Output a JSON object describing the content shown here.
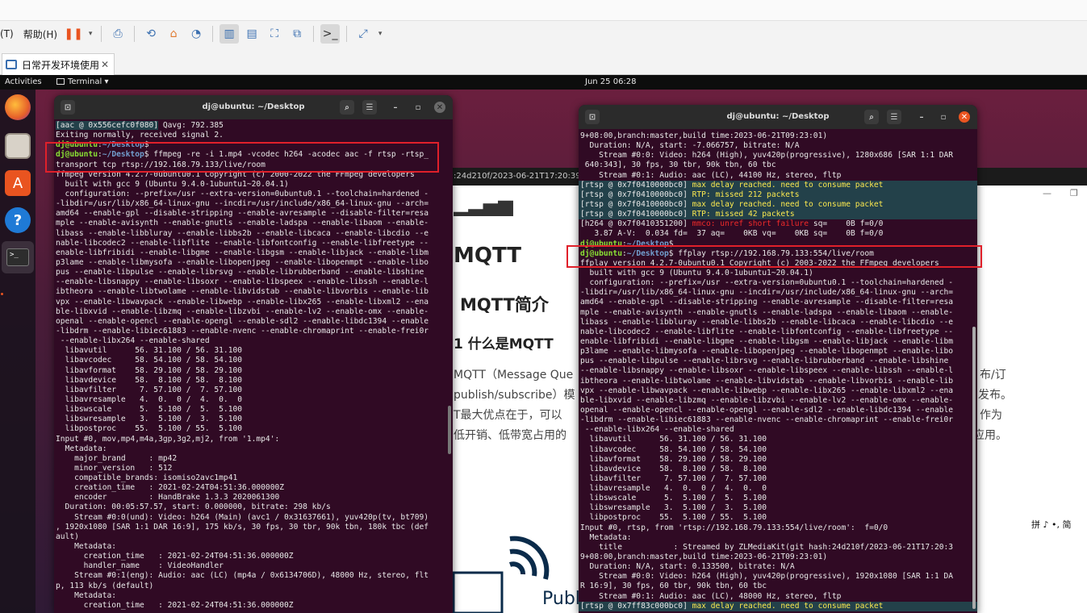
{
  "vm_app": {
    "menu_items": [
      "(T)",
      "帮助(H)"
    ],
    "tab_title": "日常开发环境使用",
    "tab_close": "✕"
  },
  "gnome": {
    "activities": "Activities",
    "app_menu": "Terminal ▾",
    "clock": "Jun 25  06:28"
  },
  "dock_apps": [
    "firefox-icon",
    "files-icon",
    "software-icon",
    "help-icon",
    "terminal-icon"
  ],
  "browser": {
    "url_fragment": ":24d210f/2023-06-21T17:20:39+08:",
    "heading_mqtt": "MQTT",
    "subheading": "MQTT简介",
    "section": "1 什么是MQTT",
    "para1": "MQTT（Message Que",
    "para1_right": "布/订",
    "para2": "publish/subscribe）模",
    "para2_right": "发布。",
    "para3": "T最大优点在于，可以",
    "para3_right": "作为",
    "para4": "低开销、低带宽占用的",
    "para4_right": "应用。",
    "bottom_text": "Publ",
    "ime": "拼 ♪ •, 简"
  },
  "left_terminal": {
    "title": "dj@ubuntu: ~/Desktop",
    "lines": [
      {
        "parts": [
          {
            "t": "[aac @ 0x556cefc0f080]",
            "c": "hl"
          },
          {
            "t": " Qavg: 792.385"
          }
        ]
      },
      {
        "parts": [
          {
            "t": "Exiting normally, received signal 2."
          }
        ]
      },
      {
        "parts": [
          {
            "t": "dj@ubuntu",
            "c": "g"
          },
          {
            "t": ":"
          },
          {
            "t": "~/Desktop",
            "c": "b"
          },
          {
            "t": "$"
          }
        ]
      },
      {
        "parts": [
          {
            "t": "dj@ubuntu",
            "c": "g"
          },
          {
            "t": ":"
          },
          {
            "t": "~/Desktop",
            "c": "b"
          },
          {
            "t": "$ ffmpeg -re -i 1.mp4 -vcodec h264 -acodec aac -f rtsp -rtsp_"
          }
        ]
      },
      {
        "parts": [
          {
            "t": "transport tcp rtsp://192.168.79.133/live/room"
          }
        ]
      },
      {
        "parts": [
          {
            "t": "ffmpeg version 4.2.7-0ubuntu0.1 Copyright (c) 2000-2022 the FFmpeg developers"
          }
        ]
      },
      {
        "parts": [
          {
            "t": "  built with gcc 9 (Ubuntu 9.4.0-1ubuntu1~20.04.1)"
          }
        ]
      },
      {
        "parts": [
          {
            "t": "  configuration: --prefix=/usr --extra-version=0ubuntu0.1 --toolchain=hardened -"
          }
        ]
      },
      {
        "parts": [
          {
            "t": "-libdir=/usr/lib/x86_64-linux-gnu --incdir=/usr/include/x86_64-linux-gnu --arch="
          }
        ]
      },
      {
        "parts": [
          {
            "t": "amd64 --enable-gpl --disable-stripping --enable-avresample --disable-filter=resa"
          }
        ]
      },
      {
        "parts": [
          {
            "t": "mple --enable-avisynth --enable-gnutls --enable-ladspa --enable-libaom --enable-"
          }
        ]
      },
      {
        "parts": [
          {
            "t": "libass --enable-libbluray --enable-libbs2b --enable-libcaca --enable-libcdio --e"
          }
        ]
      },
      {
        "parts": [
          {
            "t": "nable-libcodec2 --enable-libflite --enable-libfontconfig --enable-libfreetype --"
          }
        ]
      },
      {
        "parts": [
          {
            "t": "enable-libfribidi --enable-libgme --enable-libgsm --enable-libjack --enable-libm"
          }
        ]
      },
      {
        "parts": [
          {
            "t": "p3lame --enable-libmysofa --enable-libopenjpeg --enable-libopenmpt --enable-libo"
          }
        ]
      },
      {
        "parts": [
          {
            "t": "pus --enable-libpulse --enable-librsvg --enable-librubberband --enable-libshine"
          }
        ]
      },
      {
        "parts": [
          {
            "t": "--enable-libsnappy --enable-libsoxr --enable-libspeex --enable-libssh --enable-l"
          }
        ]
      },
      {
        "parts": [
          {
            "t": "ibtheora --enable-libtwolame --enable-libvidstab --enable-libvorbis --enable-lib"
          }
        ]
      },
      {
        "parts": [
          {
            "t": "vpx --enable-libwavpack --enable-libwebp --enable-libx265 --enable-libxml2 --ena"
          }
        ]
      },
      {
        "parts": [
          {
            "t": "ble-libxvid --enable-libzmq --enable-libzvbi --enable-lv2 --enable-omx --enable-"
          }
        ]
      },
      {
        "parts": [
          {
            "t": "openal --enable-opencl --enable-opengl --enable-sdl2 --enable-libdc1394 --enable"
          }
        ]
      },
      {
        "parts": [
          {
            "t": "-libdrm --enable-libiec61883 --enable-nvenc --enable-chromaprint --enable-frei0r"
          }
        ]
      },
      {
        "parts": [
          {
            "t": " --enable-libx264 --enable-shared"
          }
        ]
      },
      {
        "parts": [
          {
            "t": "  libavutil      56. 31.100 / 56. 31.100"
          }
        ]
      },
      {
        "parts": [
          {
            "t": "  libavcodec     58. 54.100 / 58. 54.100"
          }
        ]
      },
      {
        "parts": [
          {
            "t": "  libavformat    58. 29.100 / 58. 29.100"
          }
        ]
      },
      {
        "parts": [
          {
            "t": "  libavdevice    58.  8.100 / 58.  8.100"
          }
        ]
      },
      {
        "parts": [
          {
            "t": "  libavfilter     7. 57.100 /  7. 57.100"
          }
        ]
      },
      {
        "parts": [
          {
            "t": "  libavresample   4.  0.  0 /  4.  0.  0"
          }
        ]
      },
      {
        "parts": [
          {
            "t": "  libswscale      5.  5.100 /  5.  5.100"
          }
        ]
      },
      {
        "parts": [
          {
            "t": "  libswresample   3.  5.100 /  3.  5.100"
          }
        ]
      },
      {
        "parts": [
          {
            "t": "  libpostproc    55.  5.100 / 55.  5.100"
          }
        ]
      },
      {
        "parts": [
          {
            "t": "Input #0, mov,mp4,m4a,3gp,3g2,mj2, from '1.mp4':"
          }
        ]
      },
      {
        "parts": [
          {
            "t": "  Metadata:"
          }
        ]
      },
      {
        "parts": [
          {
            "t": "    major_brand     : mp42"
          }
        ]
      },
      {
        "parts": [
          {
            "t": "    minor_version   : 512"
          }
        ]
      },
      {
        "parts": [
          {
            "t": "    compatible_brands: isomiso2avc1mp41"
          }
        ]
      },
      {
        "parts": [
          {
            "t": "    creation_time   : 2021-02-24T04:51:36.000000Z"
          }
        ]
      },
      {
        "parts": [
          {
            "t": "    encoder         : HandBrake 1.3.3 2020061300"
          }
        ]
      },
      {
        "parts": [
          {
            "t": "  Duration: 00:05:57.57, start: 0.000000, bitrate: 298 kb/s"
          }
        ]
      },
      {
        "parts": [
          {
            "t": "    Stream #0:0(und): Video: h264 (Main) (avc1 / 0x31637661), yuv420p(tv, bt709)"
          }
        ]
      },
      {
        "parts": [
          {
            "t": ", 1920x1080 [SAR 1:1 DAR 16:9], 175 kb/s, 30 fps, 30 tbr, 90k tbn, 180k tbc (def"
          }
        ]
      },
      {
        "parts": [
          {
            "t": "ault)"
          }
        ]
      },
      {
        "parts": [
          {
            "t": "    Metadata:"
          }
        ]
      },
      {
        "parts": [
          {
            "t": "      creation_time   : 2021-02-24T04:51:36.000000Z"
          }
        ]
      },
      {
        "parts": [
          {
            "t": "      handler_name    : VideoHandler"
          }
        ]
      },
      {
        "parts": [
          {
            "t": "    Stream #0:1(eng): Audio: aac (LC) (mp4a / 0x6134706D), 48000 Hz, stereo, flt"
          }
        ]
      },
      {
        "parts": [
          {
            "t": "p, 113 kb/s (default)"
          }
        ]
      },
      {
        "parts": [
          {
            "t": "    Metadata:"
          }
        ]
      },
      {
        "parts": [
          {
            "t": "      creation_time   : 2021-02-24T04:51:36.000000Z"
          }
        ]
      }
    ]
  },
  "right_terminal": {
    "title": "dj@ubuntu: ~/Desktop",
    "lines": [
      {
        "parts": [
          {
            "t": "9+08:00,branch:master,build time:2023-06-21T09:23:01)"
          }
        ]
      },
      {
        "parts": [
          {
            "t": "  Duration: N/A, start: -7.066757, bitrate: N/A"
          }
        ]
      },
      {
        "parts": [
          {
            "t": "    Stream #0:0: Video: h264 (High), yuv420p(progressive), 1280x686 [SAR 1:1 DAR"
          }
        ]
      },
      {
        "parts": [
          {
            "t": " 640:343], 30 fps, 30 tbr, 90k tbn, 60 tbc"
          }
        ]
      },
      {
        "parts": [
          {
            "t": "    Stream #0:1: Audio: aac (LC), 44100 Hz, stereo, fltp"
          }
        ]
      },
      {
        "hl": true,
        "parts": [
          {
            "t": "[rtsp @ 0x7f0410000bc0]"
          },
          {
            "t": " max delay reached. need to consume packet",
            "c": "y"
          }
        ]
      },
      {
        "hl": true,
        "parts": [
          {
            "t": "[rtsp @ 0x7f0410000bc0]"
          },
          {
            "t": " RTP: missed 212 packets",
            "c": "y"
          }
        ]
      },
      {
        "hl": true,
        "parts": [
          {
            "t": "[rtsp @ 0x7f0410000bc0]"
          },
          {
            "t": " max delay reached. need to consume packet",
            "c": "y"
          }
        ]
      },
      {
        "hl": true,
        "parts": [
          {
            "t": "[rtsp @ 0x7f0410000bc0]"
          },
          {
            "t": " RTP: missed 42 packets",
            "c": "y"
          }
        ]
      },
      {
        "parts": [
          {
            "t": "[h264 @ 0x7f0410351200]"
          },
          {
            "t": " mmco: unref short failure",
            "c": "r"
          },
          {
            "t": " sq=    0B f=0/0"
          }
        ]
      },
      {
        "parts": [
          {
            "t": "   3.87 A-V:  0.034 fd=  37 aq=    0KB vq=    0KB sq=    0B f=0/0"
          }
        ]
      },
      {
        "parts": [
          {
            "t": "dj@ubuntu",
            "c": "g"
          },
          {
            "t": ":"
          },
          {
            "t": "~/Desktop",
            "c": "b"
          },
          {
            "t": "$"
          }
        ]
      },
      {
        "parts": [
          {
            "t": "dj@ubuntu",
            "c": "g"
          },
          {
            "t": ":"
          },
          {
            "t": "~/Desktop",
            "c": "b"
          },
          {
            "t": "$ ffplay rtsp://192.168.79.133:554/live/room"
          }
        ]
      },
      {
        "parts": [
          {
            "t": "ffplay version 4.2.7-0ubuntu0.1 Copyright (c) 2003-2022 the FFmpeg developers"
          }
        ]
      },
      {
        "parts": [
          {
            "t": "  built with gcc 9 (Ubuntu 9.4.0-1ubuntu1~20.04.1)"
          }
        ]
      },
      {
        "parts": [
          {
            "t": "  configuration: --prefix=/usr --extra-version=0ubuntu0.1 --toolchain=hardened -"
          }
        ]
      },
      {
        "parts": [
          {
            "t": "-libdir=/usr/lib/x86_64-linux-gnu --incdir=/usr/include/x86_64-linux-gnu --arch="
          }
        ]
      },
      {
        "parts": [
          {
            "t": "amd64 --enable-gpl --disable-stripping --enable-avresample --disable-filter=resa"
          }
        ]
      },
      {
        "parts": [
          {
            "t": "mple --enable-avisynth --enable-gnutls --enable-ladspa --enable-libaom --enable-"
          }
        ]
      },
      {
        "parts": [
          {
            "t": "libass --enable-libbluray --enable-libbs2b --enable-libcaca --enable-libcdio --e"
          }
        ]
      },
      {
        "parts": [
          {
            "t": "nable-libcodec2 --enable-libflite --enable-libfontconfig --enable-libfreetype --"
          }
        ]
      },
      {
        "parts": [
          {
            "t": "enable-libfribidi --enable-libgme --enable-libgsm --enable-libjack --enable-libm"
          }
        ]
      },
      {
        "parts": [
          {
            "t": "p3lame --enable-libmysofa --enable-libopenjpeg --enable-libopenmpt --enable-libo"
          }
        ]
      },
      {
        "parts": [
          {
            "t": "pus --enable-libpulse --enable-librsvg --enable-librubberband --enable-libshine"
          }
        ]
      },
      {
        "parts": [
          {
            "t": "--enable-libsnappy --enable-libsoxr --enable-libspeex --enable-libssh --enable-l"
          }
        ]
      },
      {
        "parts": [
          {
            "t": "ibtheora --enable-libtwolame --enable-libvidstab --enable-libvorbis --enable-lib"
          }
        ]
      },
      {
        "parts": [
          {
            "t": "vpx --enable-libwavpack --enable-libwebp --enable-libx265 --enable-libxml2 --ena"
          }
        ]
      },
      {
        "parts": [
          {
            "t": "ble-libxvid --enable-libzmq --enable-libzvbi --enable-lv2 --enable-omx --enable-"
          }
        ]
      },
      {
        "parts": [
          {
            "t": "openal --enable-opencl --enable-opengl --enable-sdl2 --enable-libdc1394 --enable"
          }
        ]
      },
      {
        "parts": [
          {
            "t": "-libdrm --enable-libiec61883 --enable-nvenc --enable-chromaprint --enable-frei0r"
          }
        ]
      },
      {
        "parts": [
          {
            "t": " --enable-libx264 --enable-shared"
          }
        ]
      },
      {
        "parts": [
          {
            "t": "  libavutil      56. 31.100 / 56. 31.100"
          }
        ]
      },
      {
        "parts": [
          {
            "t": "  libavcodec     58. 54.100 / 58. 54.100"
          }
        ]
      },
      {
        "parts": [
          {
            "t": "  libavformat    58. 29.100 / 58. 29.100"
          }
        ]
      },
      {
        "parts": [
          {
            "t": "  libavdevice    58.  8.100 / 58.  8.100"
          }
        ]
      },
      {
        "parts": [
          {
            "t": "  libavfilter     7. 57.100 /  7. 57.100"
          }
        ]
      },
      {
        "parts": [
          {
            "t": "  libavresample   4.  0.  0 /  4.  0.  0"
          }
        ]
      },
      {
        "parts": [
          {
            "t": "  libswscale      5.  5.100 /  5.  5.100"
          }
        ]
      },
      {
        "parts": [
          {
            "t": "  libswresample   3.  5.100 /  3.  5.100"
          }
        ]
      },
      {
        "parts": [
          {
            "t": "  libpostproc    55.  5.100 / 55.  5.100"
          }
        ]
      },
      {
        "parts": [
          {
            "t": "Input #0, rtsp, from 'rtsp://192.168.79.133:554/live/room':  f=0/0"
          }
        ]
      },
      {
        "parts": [
          {
            "t": "  Metadata:"
          }
        ]
      },
      {
        "parts": [
          {
            "t": "    title           : Streamed by ZLMediaKit(git hash:24d210f/2023-06-21T17:20:3"
          }
        ]
      },
      {
        "parts": [
          {
            "t": "9+08:00,branch:master,build time:2023-06-21T09:23:01)"
          }
        ]
      },
      {
        "parts": [
          {
            "t": "  Duration: N/A, start: 0.133500, bitrate: N/A"
          }
        ]
      },
      {
        "parts": [
          {
            "t": "    Stream #0:0: Video: h264 (High), yuv420p(progressive), 1920x1080 [SAR 1:1 DA"
          }
        ]
      },
      {
        "parts": [
          {
            "t": "R 16:9], 30 fps, 60 tbr, 90k tbn, 60 tbc"
          }
        ]
      },
      {
        "parts": [
          {
            "t": "    Stream #0:1: Audio: aac (LC), 48000 Hz, stereo, fltp"
          }
        ]
      },
      {
        "hl": true,
        "parts": [
          {
            "t": "[rtsp @ 0x7ff83c000bc0]"
          },
          {
            "t": " max delay reached. need to consume packet",
            "c": "y"
          }
        ]
      }
    ]
  }
}
